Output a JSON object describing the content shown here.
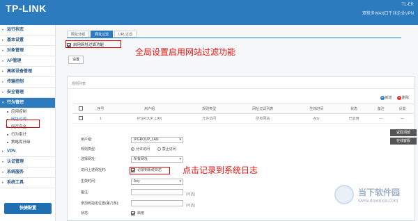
{
  "header": {
    "logo": "TP-LINK",
    "model": "TL-ER",
    "model_desc": "双核多WAN口千兆企业VPN"
  },
  "sidebar": {
    "items": [
      {
        "label": "运行状态"
      },
      {
        "label": "基本设置"
      },
      {
        "label": "对象管理"
      },
      {
        "label": "AP管理"
      },
      {
        "label": "高级设备管理"
      },
      {
        "label": "传输控制"
      },
      {
        "label": "安全管理"
      },
      {
        "label": "行为管控"
      },
      {
        "label": "VPN"
      },
      {
        "label": "认证管理"
      },
      {
        "label": "系统服务"
      },
      {
        "label": "系统工具"
      }
    ],
    "sub_items": [
      {
        "label": "应用控制"
      },
      {
        "label": "网址过滤"
      },
      {
        "label": "网页安全"
      },
      {
        "label": "行为审计"
      },
      {
        "label": "策略库升级"
      }
    ],
    "quick_button": "快捷配置"
  },
  "tabs": [
    {
      "label": "网址分组"
    },
    {
      "label": "网址过滤"
    },
    {
      "label": "URL过滤"
    }
  ],
  "global": {
    "checkbox_label": "启用网址过滤功能",
    "set_button": "设置",
    "annotation": "全局设置启用网站过滤功能"
  },
  "panel": {
    "title": "规则列表",
    "add_label": "新增",
    "delete_label": "删除"
  },
  "table": {
    "headers": [
      "",
      "序号",
      "用户组",
      "规则类型",
      "网址过滤列表",
      "生效时间",
      "状态",
      "备注",
      "设置"
    ],
    "row": [
      "",
      "1",
      "IPGROUP_LAN",
      "允许访问",
      "所有网站",
      "Any",
      "已启用",
      "---",
      "---"
    ]
  },
  "form": {
    "user_group_label": "用户组:",
    "user_group_value": "IPGROUP_LAN",
    "rule_type_label": "规则类型:",
    "rule_allow": "允许访问",
    "rule_deny": "禁止访问",
    "select_site_label": "选择网址:",
    "select_site_value": "所有网址",
    "log_label": "访问上述网址时:",
    "log_value": "记录到系统日志",
    "time_label": "生效时间:",
    "time_value": "Any",
    "remark_label": "备注:",
    "optional": "(可选)",
    "position_label": "添加到指定位置(第几条):",
    "status_label": "状态:",
    "status_value": "启用",
    "annotation": "点击记录到系统日志"
  },
  "right_buttons": {
    "back_top": "返回顶部",
    "online_help": "在线客服"
  },
  "watermark": {
    "text": "当下软件园",
    "url": "www.downxia.com"
  }
}
